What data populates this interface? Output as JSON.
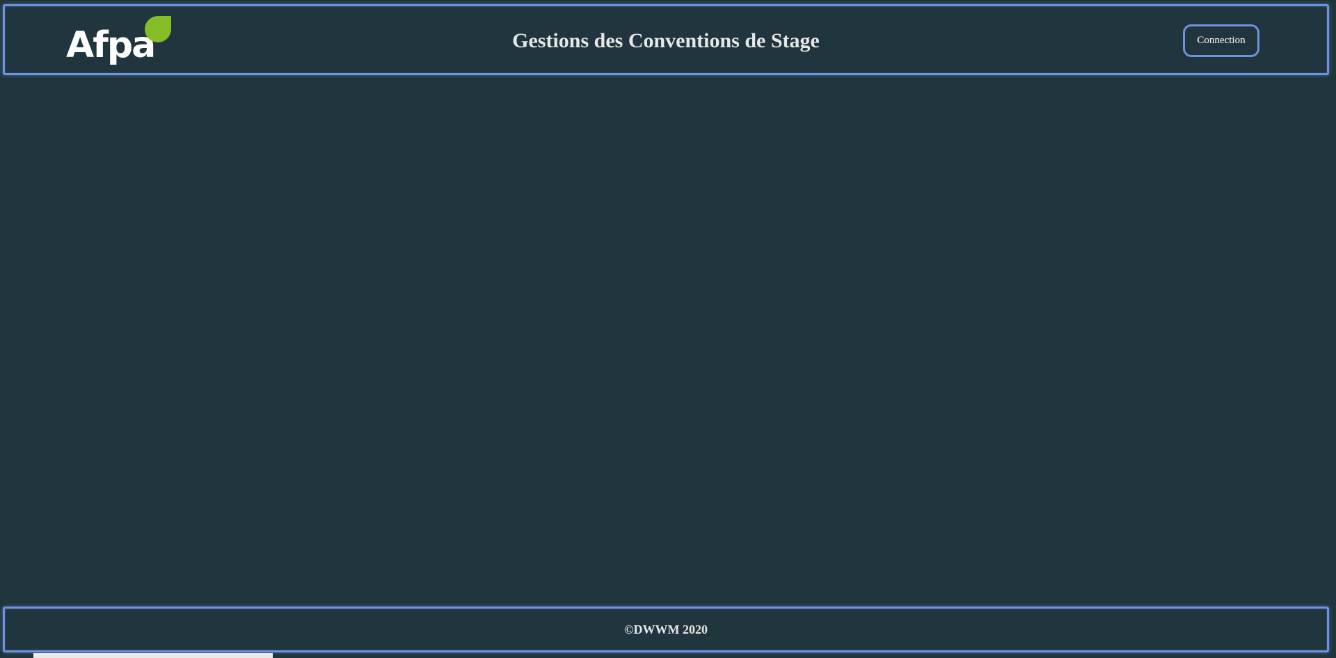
{
  "header": {
    "logo_text": "Afpa",
    "title": "Gestions des Conventions de Stage",
    "connect_label": "Connection"
  },
  "footer": {
    "copyright": "©DWWM 2020"
  },
  "colors": {
    "background": "#20353d",
    "border_accent": "#6f93e0",
    "logo_leaf": "#85bd29",
    "text": "#e7e7e7"
  }
}
